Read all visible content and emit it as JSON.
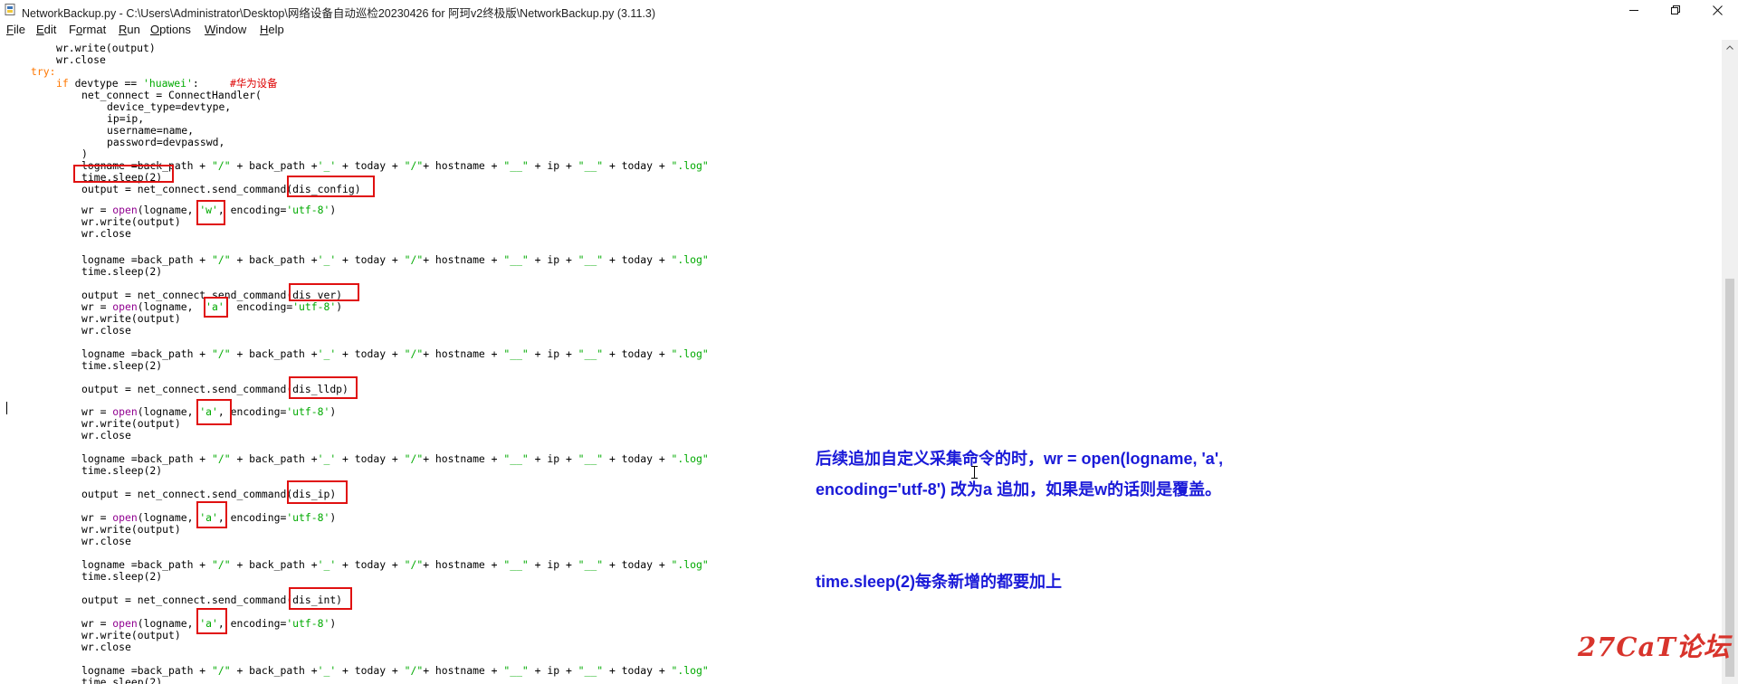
{
  "window": {
    "title": "NetworkBackup.py - C:\\Users\\Administrator\\Desktop\\网络设备自动巡检20230426 for 阿珂v2终极版\\NetworkBackup.py (3.11.3)"
  },
  "menu": [
    {
      "pre": "",
      "u": "F",
      "post": "ile"
    },
    {
      "pre": "",
      "u": "E",
      "post": "dit"
    },
    {
      "pre": "F",
      "u": "o",
      "post": "rmat"
    },
    {
      "pre": "",
      "u": "R",
      "post": "un"
    },
    {
      "pre": "",
      "u": "O",
      "post": "ptions"
    },
    {
      "pre": "",
      "u": "W",
      "post": "indow"
    },
    {
      "pre": "",
      "u": "H",
      "post": "elp"
    }
  ],
  "code": {
    "L0": "wr.write(output)",
    "L1": "wr.close",
    "L2": "try:",
    "L3": {
      "kw": "if",
      "a": " devtype == ",
      "str": "'huawei'",
      "b": ":     ",
      "comment": "#华为设备"
    },
    "L4": "net_connect = ConnectHandler(",
    "L5": "device_type=devtype,",
    "L6": "ip=ip,",
    "L7": "username=name,",
    "L8": "password=devpasswd,",
    "L9": ")",
    "logname": [
      "logname =back_path + ",
      "\"/\"",
      " + back_path +",
      "'_'",
      " + today + ",
      "\"/\"",
      "+ hostname + ",
      "\"__\"",
      " + ip + ",
      "\"__\"",
      " + today + ",
      "\".log\""
    ],
    "sleep": "time.sleep(2)",
    "send_prefix": "output = net_connect.send_command",
    "commands": [
      "(dis_config)",
      "(dis_ver)",
      "(dis_lldp)",
      "(dis_ip)",
      "(dis_int)"
    ],
    "wr_w": [
      "wr = ",
      "open",
      "(logname, ",
      "'w'",
      ", encoding=",
      "'utf-8'",
      ")"
    ],
    "wr_a": [
      "wr = ",
      "open",
      "(logname, ",
      "'a'",
      ", encoding=",
      "'utf-8'",
      ")"
    ],
    "wr_a2": [
      "wr = ",
      "open",
      "(logname,  ",
      "'a'",
      ", encoding=",
      "'utf-8'",
      ")"
    ],
    "write": "wr.write(output)",
    "close": "wr.close"
  },
  "annotations": {
    "line1": "后续追加自定义采集命令的时，wr = open(logname, 'a',",
    "line2": "encoding='utf-8') 改为a 追加，如果是w的话则是覆盖。",
    "line3": "time.sleep(2)每条新增的都要加上"
  },
  "watermark": "27CaT论坛",
  "colors": {
    "keyword": "#ff7700",
    "string": "#00aa00",
    "comment": "#dd0000",
    "builtin": "#900090",
    "highlight_box": "#e01010",
    "annotation": "#1a1ad8",
    "watermark": "#d8342c"
  }
}
